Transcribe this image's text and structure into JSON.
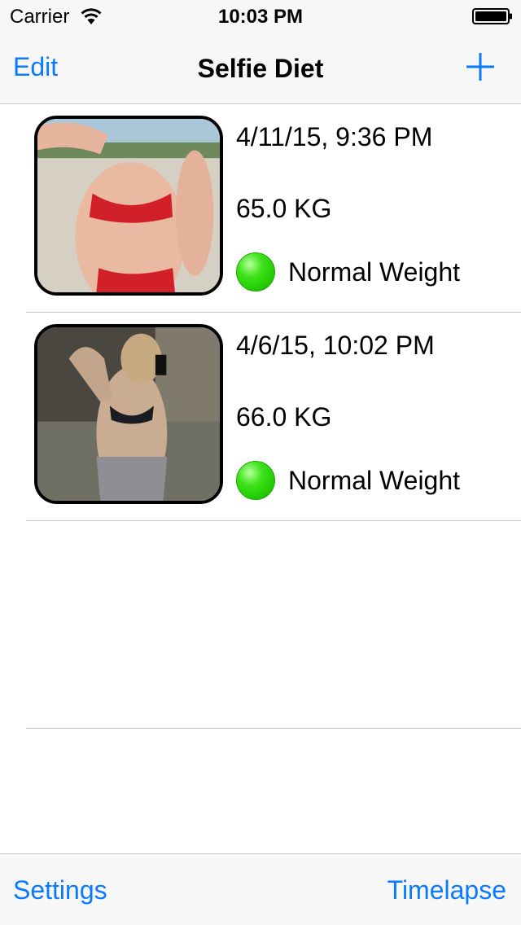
{
  "status_bar": {
    "carrier": "Carrier",
    "time": "10:03 PM"
  },
  "nav": {
    "edit_label": "Edit",
    "title": "Selfie Diet",
    "add_icon": "plus-icon"
  },
  "entries": [
    {
      "date": "4/11/15, 9:36 PM",
      "weight": "65.0 KG",
      "status": "Normal Weight",
      "status_color": "#2fe01b"
    },
    {
      "date": "4/6/15, 10:02 PM",
      "weight": "66.0 KG",
      "status": "Normal Weight",
      "status_color": "#2fe01b"
    }
  ],
  "toolbar": {
    "settings_label": "Settings",
    "timelapse_label": "Timelapse"
  },
  "colors": {
    "accent": "#0a7aff",
    "bar_background": "#f7f7f7",
    "separator": "#c8c7cc"
  }
}
